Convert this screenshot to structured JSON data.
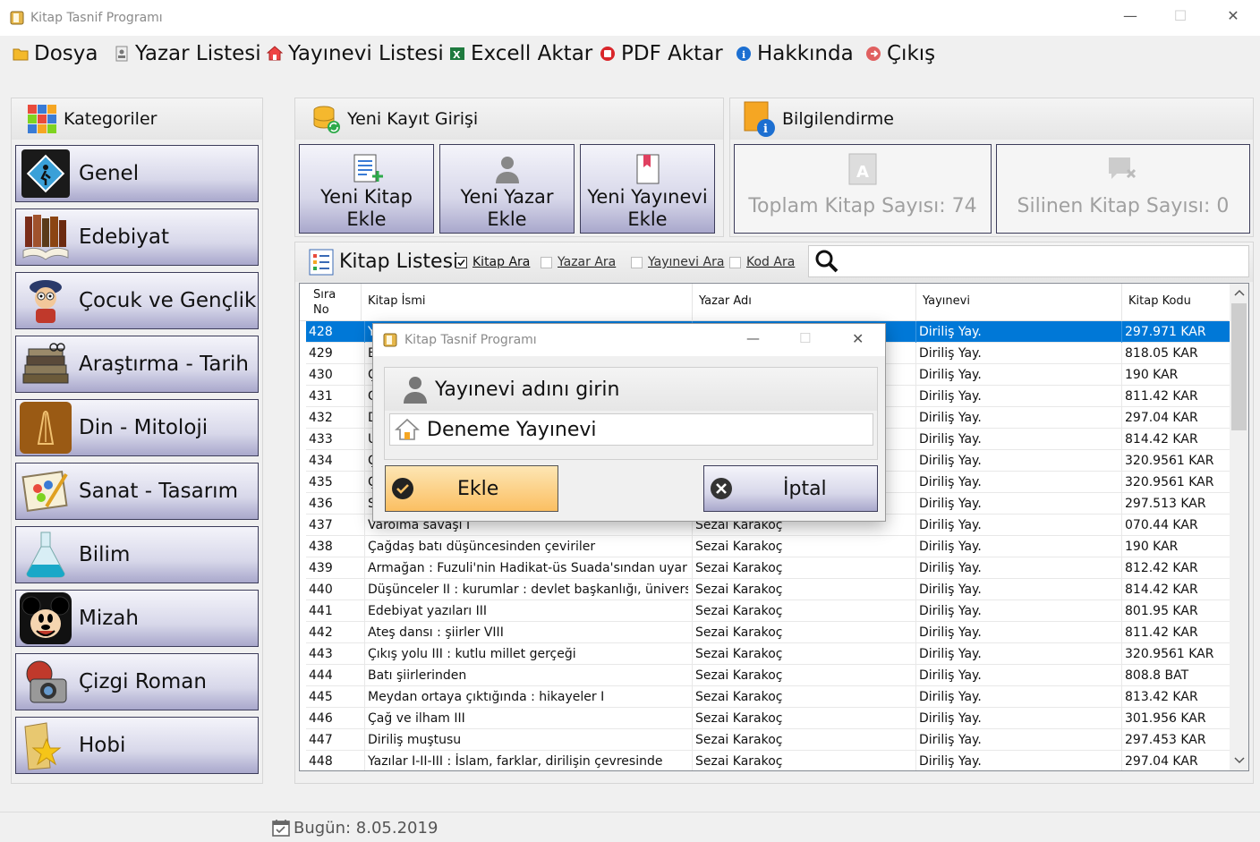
{
  "window": {
    "title": "Kitap Tasnif Programı",
    "minimize": "—",
    "maximize": "☐",
    "close": "✕"
  },
  "menu": [
    {
      "label": "Dosya",
      "icon": "folder-icon"
    },
    {
      "label": "Yazar Listesi",
      "icon": "document-icon"
    },
    {
      "label": "Yayınevi Listesi",
      "icon": "home-icon"
    },
    {
      "label": "Excell Aktar",
      "icon": "excel-icon"
    },
    {
      "label": "PDF Aktar",
      "icon": "pdf-icon"
    },
    {
      "label": "Hakkında",
      "icon": "info-icon"
    },
    {
      "label": "Çıkış",
      "icon": "exit-icon"
    }
  ],
  "categories": {
    "title": "Kategoriler",
    "items": [
      {
        "label": "Genel",
        "icon": "general-icon"
      },
      {
        "label": "Edebiyat",
        "icon": "books-icon"
      },
      {
        "label": "Çocuk ve Gençlik",
        "icon": "child-icon"
      },
      {
        "label": "Araştırma - Tarih",
        "icon": "history-books-icon"
      },
      {
        "label": "Din - Mitoloji",
        "icon": "praying-hands-icon"
      },
      {
        "label": "Sanat - Tasarım",
        "icon": "art-icon"
      },
      {
        "label": "Bilim",
        "icon": "flask-icon"
      },
      {
        "label": "Mizah",
        "icon": "mickey-icon"
      },
      {
        "label": "Çizgi Roman",
        "icon": "comic-camera-icon"
      },
      {
        "label": "Hobi",
        "icon": "star-folder-icon"
      }
    ]
  },
  "new_entry": {
    "title": "Yeni Kayıt Girişi",
    "buttons": [
      {
        "label": "Yeni Kitap\nEkle"
      },
      {
        "label": "Yeni Yazar\nEkle"
      },
      {
        "label": "Yeni Yayınevi\nEkle"
      }
    ]
  },
  "info": {
    "title": "Bilgilendirme",
    "total_books": "Toplam Kitap Sayısı: 74",
    "deleted_books": "Silinen Kitap Sayısı: 0"
  },
  "book_list": {
    "title": "Kitap Listesi",
    "search_options": [
      {
        "label": "Kitap Ara",
        "checked": true
      },
      {
        "label": "Yazar Ara",
        "checked": false
      },
      {
        "label": "Yayınevi Ara",
        "checked": false
      },
      {
        "label": "Kod Ara",
        "checked": false
      }
    ],
    "search_value": "",
    "columns": [
      "Sıra\nNo",
      "Kitap İsmi",
      "Yazar Adı",
      "Yayınevi",
      "Kitap Kodu"
    ],
    "rows": [
      [
        "428",
        "Y",
        "",
        "Diriliş Yay.",
        "297.971 KAR"
      ],
      [
        "429",
        "E",
        "",
        "Diriliş Yay.",
        "818.05 KAR"
      ],
      [
        "430",
        "Ç",
        "",
        "Diriliş Yay.",
        "190 KAR"
      ],
      [
        "431",
        "G",
        "",
        "Diriliş Yay.",
        "811.42 KAR"
      ],
      [
        "432",
        "D",
        "",
        "Diriliş Yay.",
        "297.04 KAR"
      ],
      [
        "433",
        "U",
        "",
        "Diriliş Yay.",
        "814.42 KAR"
      ],
      [
        "434",
        "Ç",
        "",
        "Diriliş Yay.",
        "320.9561 KAR"
      ],
      [
        "435",
        "Ç",
        "",
        "Diriliş Yay.",
        "320.9561 KAR"
      ],
      [
        "436",
        "S",
        "",
        "Diriliş Yay.",
        "297.513 KAR"
      ],
      [
        "437",
        "Varolma savaşı I",
        "Sezai Karakoç",
        "Diriliş Yay.",
        "070.44 KAR"
      ],
      [
        "438",
        "Çağdaş batı düşüncesinden çeviriler",
        "Sezai Karakoç",
        "Diriliş Yay.",
        "190 KAR"
      ],
      [
        "439",
        "Armağan : Fuzuli'nin Hadikat-üs Suada'sından uyarlama",
        "Sezai Karakoç",
        "Diriliş Yay.",
        "812.42 KAR"
      ],
      [
        "440",
        "Düşünceler II : kurumlar : devlet başkanlığı, üniversite, tel...",
        "Sezai Karakoç",
        "Diriliş Yay.",
        "814.42 KAR"
      ],
      [
        "441",
        "Edebiyat yazıları III",
        "Sezai Karakoç",
        "Diriliş Yay.",
        "801.95 KAR"
      ],
      [
        "442",
        "Ateş dansı : şiirler VIII",
        "Sezai Karakoç",
        "Diriliş Yay.",
        "811.42 KAR"
      ],
      [
        "443",
        "Çıkış yolu III : kutlu millet gerçeği",
        "Sezai Karakoç",
        "Diriliş Yay.",
        "320.9561 KAR"
      ],
      [
        "444",
        "Batı şiirlerinden",
        "Sezai Karakoç",
        "Diriliş Yay.",
        "808.8 BAT"
      ],
      [
        "445",
        "Meydan ortaya çıktığında : hikayeler I",
        "Sezai Karakoç",
        "Diriliş Yay.",
        "813.42 KAR"
      ],
      [
        "446",
        "Çağ ve ilham III",
        "Sezai Karakoç",
        "Diriliş Yay.",
        "301.956 KAR"
      ],
      [
        "447",
        "Diriliş muştusu",
        "Sezai Karakoç",
        "Diriliş Yay.",
        "297.453 KAR"
      ],
      [
        "448",
        "Yazılar I-II-III : İslam, farklar, dirilişin çevresinde",
        "Sezai Karakoç",
        "Diriliş Yay.",
        "297.04 KAR"
      ]
    ],
    "selected_row": 0
  },
  "dialog": {
    "title": "Kitap Tasnif Programı",
    "minimize": "—",
    "maximize": "☐",
    "close": "✕",
    "prompt": "Yayınevi adını girin",
    "input_value": "Deneme Yayınevi",
    "ok_label": "Ekle",
    "cancel_label": "İptal"
  },
  "status": {
    "date": "Bugün: 8.05.2019"
  },
  "colors": {
    "selected_row": "#0078d7",
    "accent_orange": "#fbbf62",
    "button_gradient_bottom": "#a9a8cc"
  }
}
